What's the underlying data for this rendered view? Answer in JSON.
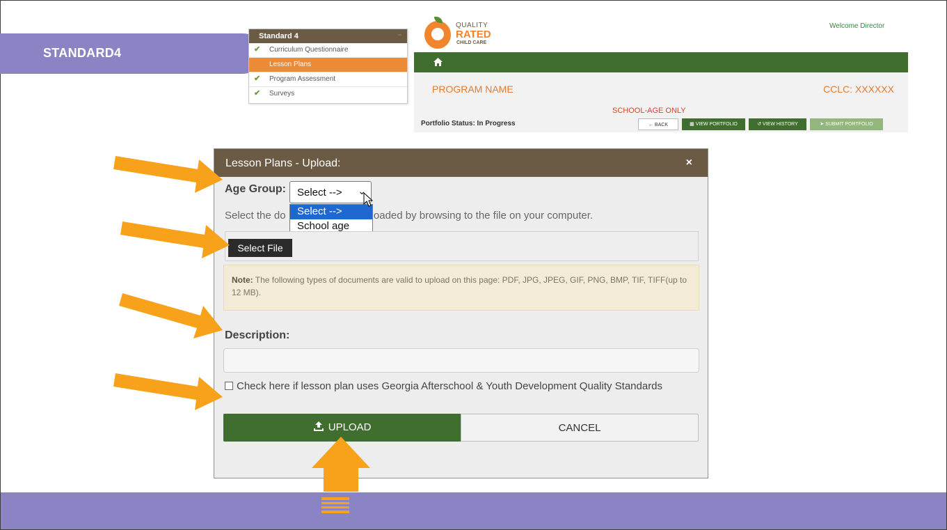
{
  "slide": {
    "tab_label": "STANDARD4",
    "colors": {
      "tab": "#8b84c4",
      "arrow": "#f7a21a"
    }
  },
  "menu": {
    "title": "Standard 4",
    "items": [
      {
        "label": "Curriculum Questionnaire",
        "checked": true,
        "active": false
      },
      {
        "label": "Lesson Plans",
        "checked": false,
        "active": true
      },
      {
        "label": "Program Assessment",
        "checked": true,
        "active": false
      },
      {
        "label": "Surveys",
        "checked": true,
        "active": false
      }
    ]
  },
  "portal": {
    "logo": {
      "line1": "QUALITY",
      "line2": "RATED",
      "line3": "CHILD CARE"
    },
    "welcome": "Welcome Director",
    "home_icon": "home-icon",
    "program_name": "PROGRAM NAME",
    "cclc": "CCLC: XXXXXX",
    "age_note": "SCHOOL-AGE ONLY",
    "portfolio_status": "Portfolio Status: In Progress",
    "buttons": {
      "back": "← BACK",
      "view_portfolio": "VIEW PORTFOLIO",
      "view_history": "VIEW HISTORY",
      "submit_portfolio": "SUBMIT PORTFOLIO"
    }
  },
  "modal": {
    "title": "Lesson Plans - Upload:",
    "close": "×",
    "age_group_label": "Age Group:",
    "age_group_value": "Select -->",
    "age_group_options": [
      "Select -->",
      "School age"
    ],
    "instruction_left": "Select the do",
    "instruction_right": "loaded by browsing to the file on your computer.",
    "select_file": "Select File",
    "note_bold": "Note:",
    "note_text": " The following types of documents are valid to upload on this page: PDF, JPG, JPEG, GIF, PNG, BMP, TIF, TIFF(up to 12 MB).",
    "description_label": "Description:",
    "description_value": "",
    "checkbox_label": "Check here if lesson plan uses Georgia Afterschool & Youth Development Quality Standards",
    "checkbox_checked": false,
    "upload": "UPLOAD",
    "cancel": "CANCEL"
  }
}
